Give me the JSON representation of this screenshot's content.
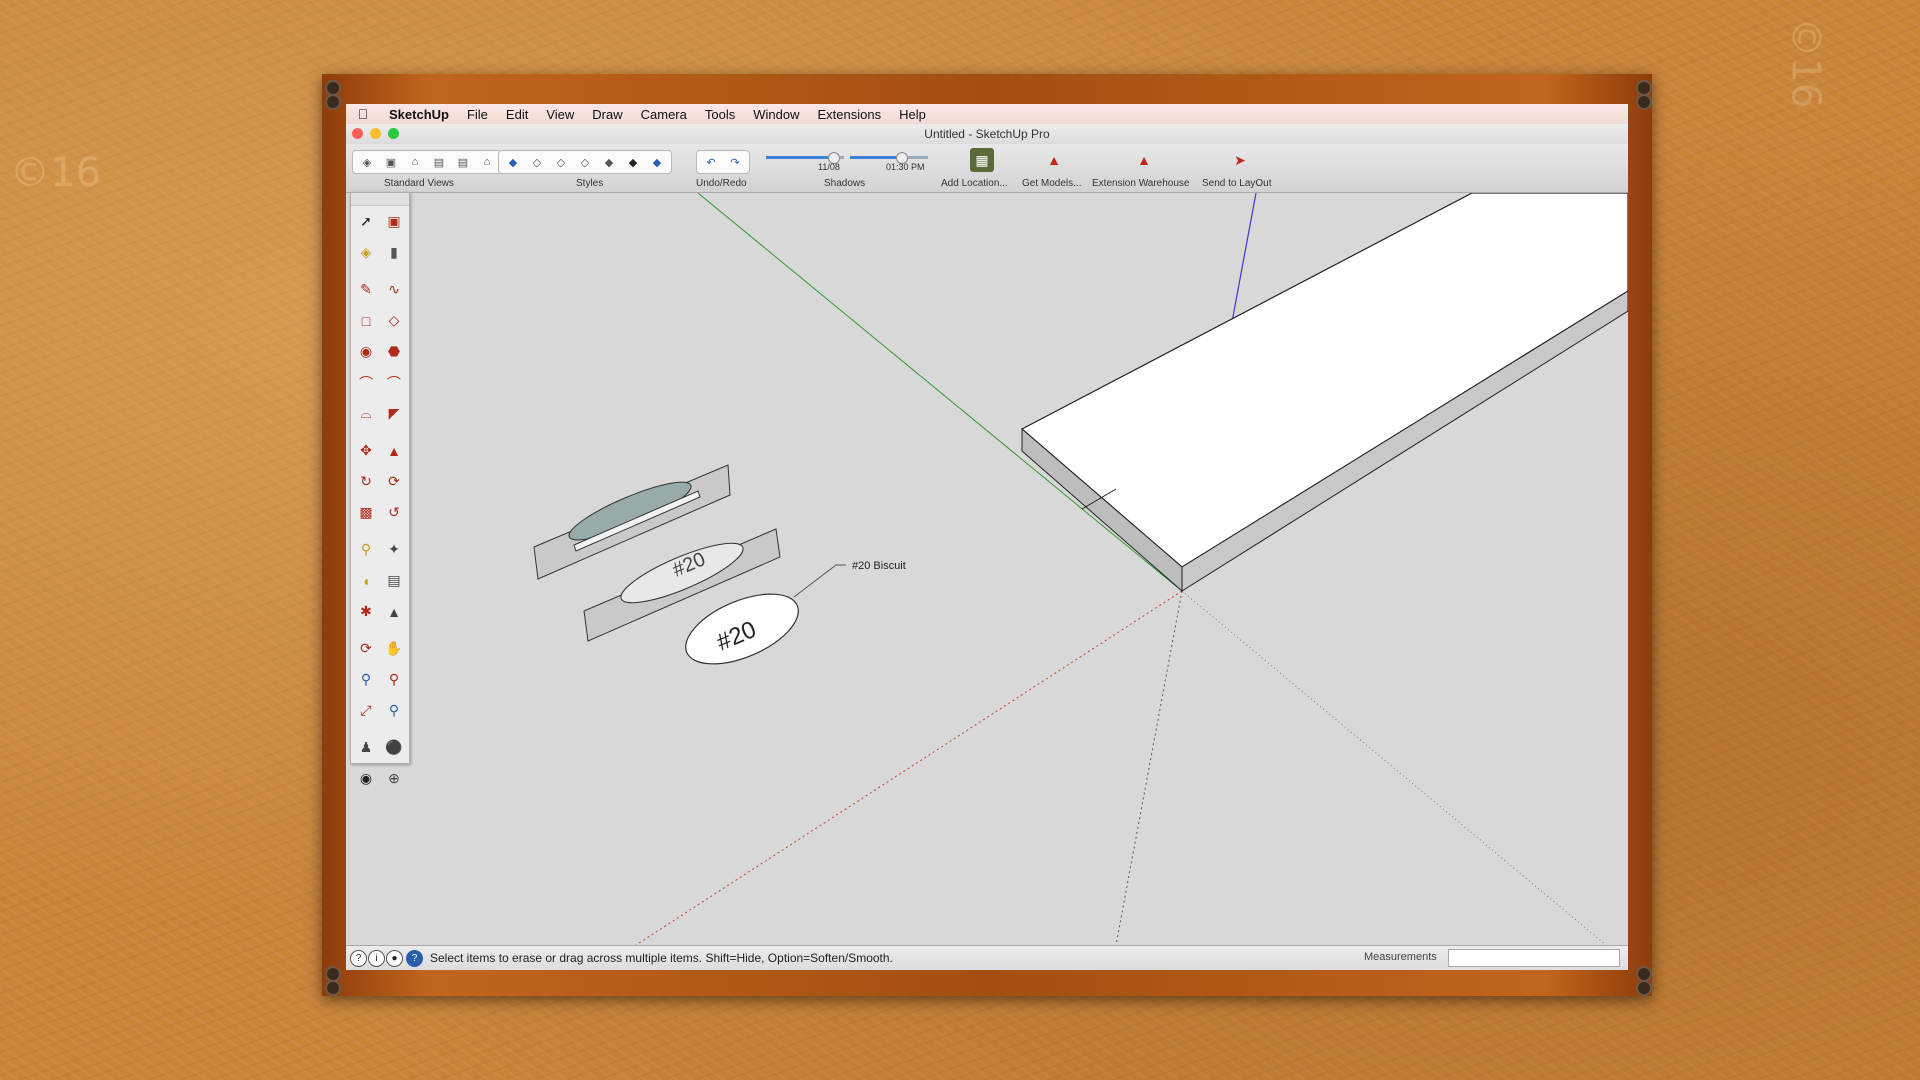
{
  "menubar": {
    "app_name": "SketchUp",
    "items": [
      "File",
      "Edit",
      "View",
      "Draw",
      "Camera",
      "Tools",
      "Window",
      "Extensions",
      "Help"
    ]
  },
  "window": {
    "title": "Untitled - SketchUp Pro"
  },
  "toolbar": {
    "groups": {
      "standard_views": "Standard Views",
      "styles": "Styles",
      "undo_redo": "Undo/Redo",
      "shadows": "Shadows"
    },
    "shadow_date": "11/08",
    "shadow_time": "01:30 PM",
    "add_location": "Add Location...",
    "get_models": "Get Models...",
    "extension_warehouse": "Extension Warehouse",
    "send_to_layout": "Send to LayOut"
  },
  "model": {
    "label": "#20 Biscuit",
    "biscuit_text": "#20"
  },
  "status": {
    "message": "Select items to erase or drag across multiple items. Shift=Hide, Option=Soften/Smooth.",
    "measurements_label": "Measurements",
    "measurements_value": ""
  },
  "colors": {
    "accent": "#3b82d6",
    "tool_red": "#b02a1a",
    "frame": "#b2561a"
  }
}
